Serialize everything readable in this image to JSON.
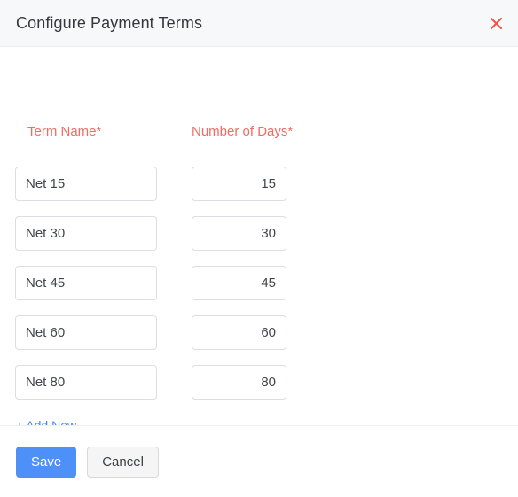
{
  "dialog": {
    "title": "Configure Payment Terms",
    "close_icon": "close-icon"
  },
  "columns": {
    "term_name": "Term Name*",
    "number_of_days": "Number of Days*"
  },
  "rows": [
    {
      "term_name": "Net 15",
      "days": "15"
    },
    {
      "term_name": "Net 30",
      "days": "30"
    },
    {
      "term_name": "Net 45",
      "days": "45"
    },
    {
      "term_name": "Net 60",
      "days": "60"
    },
    {
      "term_name": "Net 80",
      "days": "80"
    }
  ],
  "add_new": {
    "label": "+ Add New"
  },
  "footer": {
    "save_label": "Save",
    "cancel_label": "Cancel"
  },
  "colors": {
    "header_background": "#f7f8fa",
    "required_label": "#f26b62",
    "close_icon": "#f4514a",
    "link": "#408cf5",
    "primary_button": "#4d90f7",
    "secondary_button": "#f5f5f5",
    "field_border": "#dcdde5",
    "title_text": "#34383d"
  }
}
